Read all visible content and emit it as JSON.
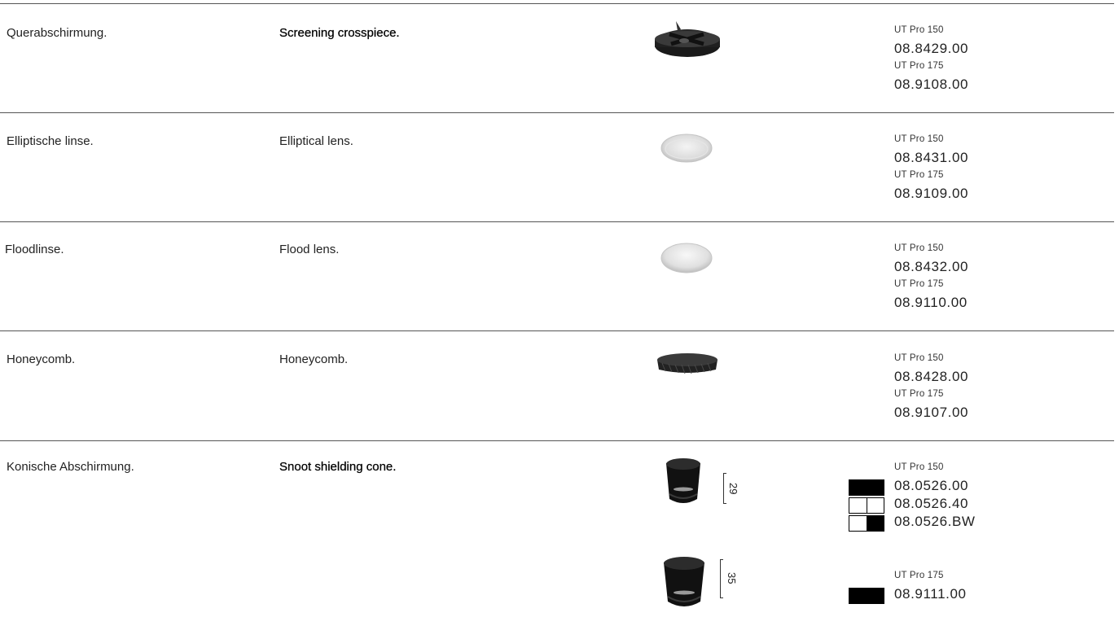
{
  "rows": [
    {
      "de": "Querabschirmung.",
      "en": "Screening crosspiece.",
      "icon": "crosspiece-icon",
      "variants": [
        {
          "model": "UT Pro 150",
          "code": "08.8429.00"
        },
        {
          "model": "UT Pro 175",
          "code": "08.9108.00"
        }
      ]
    },
    {
      "de": "Elliptische linse.",
      "en": "Elliptical lens.",
      "icon": "elliptical-lens-icon",
      "variants": [
        {
          "model": "UT Pro 150",
          "code": "08.8431.00"
        },
        {
          "model": "UT Pro 175",
          "code": "08.9109.00"
        }
      ]
    },
    {
      "de": "Floodlinse.",
      "en": "Flood lens.",
      "icon": "flood-lens-icon",
      "variants": [
        {
          "model": "UT Pro 150",
          "code": "08.8432.00"
        },
        {
          "model": "UT Pro 175",
          "code": "08.9110.00"
        }
      ]
    },
    {
      "de": "Honeycomb.",
      "en": "Honeycomb.",
      "icon": "honeycomb-icon",
      "variants": [
        {
          "model": "UT Pro 150",
          "code": "08.8428.00"
        },
        {
          "model": "UT Pro 175",
          "code": "08.9107.00"
        }
      ]
    }
  ],
  "snoot": {
    "de": "Konische Abschirmung.",
    "en": "Snoot shielding cone.",
    "icon": "snoot-cone-icon",
    "small": {
      "dimension": "29",
      "model": "UT Pro 150",
      "codes": [
        {
          "code": "08.0526.00",
          "swatch": "black"
        },
        {
          "code": "08.0526.40",
          "swatch": "white"
        },
        {
          "code": "08.0526.BW",
          "swatch": "white-black"
        }
      ]
    },
    "large": {
      "dimension": "35",
      "model": "UT Pro 175",
      "codes": [
        {
          "code": "08.9111.00",
          "swatch": "black"
        }
      ]
    }
  },
  "colors": {
    "rule": "#555555",
    "black": "#000000"
  }
}
